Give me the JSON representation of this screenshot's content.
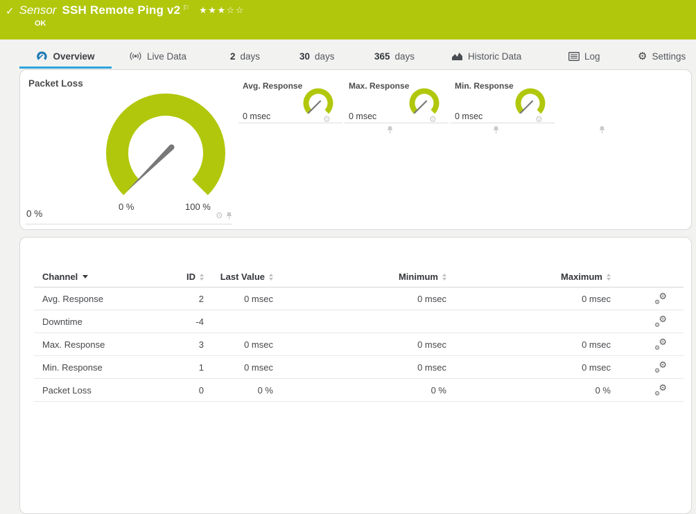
{
  "colors": {
    "brand_green": "#b1c70c",
    "accent_blue": "#2da4dc",
    "icon_blue": "#1d7ab3",
    "needle_gray": "#787878"
  },
  "header": {
    "kind": "Sensor",
    "title": "SSH Remote Ping v2",
    "status": "OK",
    "stars_filled": "★★★",
    "stars_empty": "☆☆"
  },
  "tabs": [
    {
      "icon": "gauge",
      "label": "Overview",
      "active": true
    },
    {
      "icon": "live",
      "label": "Live Data"
    },
    {
      "num": "2",
      "label": "days"
    },
    {
      "num": "30",
      "label": "days"
    },
    {
      "num": "365",
      "label": "days"
    },
    {
      "icon": "chart",
      "label": "Historic Data"
    },
    {
      "icon": "log",
      "label": "Log"
    },
    {
      "icon": "gear",
      "label": "Settings"
    }
  ],
  "gauges": {
    "primary": {
      "title": "Packet Loss",
      "value": "0 %",
      "scale_min": "0 %",
      "scale_max": "100 %"
    },
    "small": [
      {
        "title": "Avg. Response",
        "value": "0 msec"
      },
      {
        "title": "Max. Response",
        "value": "0 msec"
      },
      {
        "title": "Min. Response",
        "value": "0 msec"
      }
    ]
  },
  "table": {
    "columns": {
      "channel": "Channel",
      "id": "ID",
      "last_value": "Last Value",
      "minimum": "Minimum",
      "maximum": "Maximum"
    },
    "rows": [
      {
        "channel": "Avg. Response",
        "id": "2",
        "last": "0 msec",
        "min": "0 msec",
        "max": "0 msec"
      },
      {
        "channel": "Downtime",
        "id": "-4",
        "last": "",
        "min": "",
        "max": ""
      },
      {
        "channel": "Max. Response",
        "id": "3",
        "last": "0 msec",
        "min": "0 msec",
        "max": "0 msec"
      },
      {
        "channel": "Min. Response",
        "id": "1",
        "last": "0 msec",
        "min": "0 msec",
        "max": "0 msec"
      },
      {
        "channel": "Packet Loss",
        "id": "0",
        "last": "0 %",
        "min": "0 %",
        "max": "0 %"
      }
    ]
  }
}
